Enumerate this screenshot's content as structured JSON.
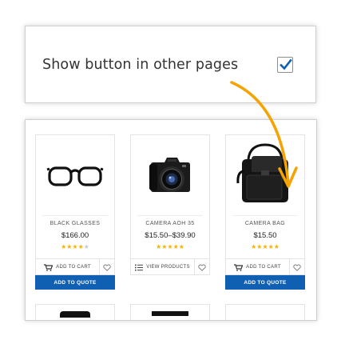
{
  "settings": {
    "label": "Show button in other pages",
    "checked": true,
    "accent_color": "#0f5fb3"
  },
  "products": [
    {
      "name": "BLACK GLASSES",
      "price": "$166.00",
      "rating": 4,
      "max_rating": 5,
      "image": "glasses-image",
      "action_label": "ADD TO CART",
      "action_icon": "cart-icon",
      "quote_label": "ADD TO QUOTE",
      "has_quote": true
    },
    {
      "name": "CAMERA AOH 35",
      "price": "$15.50–$39.90",
      "rating": 5,
      "max_rating": 5,
      "image": "camera-image",
      "action_label": "VIEW PRODUCTS",
      "action_icon": "list-icon",
      "has_quote": false
    },
    {
      "name": "CAMERA BAG",
      "price": "$15.50",
      "rating": 5,
      "max_rating": 5,
      "image": "camera-bag-image",
      "action_label": "ADD TO CART",
      "action_icon": "cart-icon",
      "quote_label": "ADD TO QUOTE",
      "has_quote": true
    }
  ],
  "colors": {
    "star": "#f5b301",
    "quote_button": "#0f5fb3",
    "arrow": "#f5a300"
  }
}
